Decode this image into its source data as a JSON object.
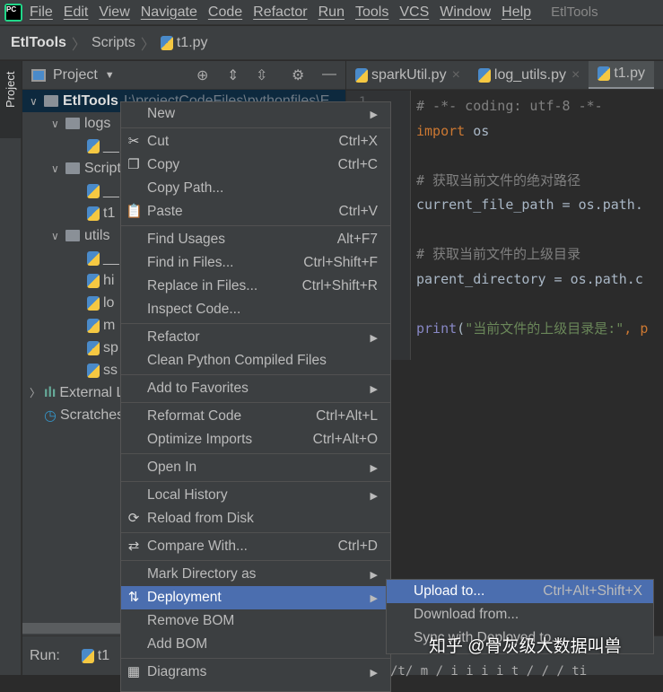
{
  "menubar": {
    "items": [
      "File",
      "Edit",
      "View",
      "Navigate",
      "Code",
      "Refactor",
      "Run",
      "Tools",
      "VCS",
      "Window",
      "Help"
    ],
    "title": "EtlTools"
  },
  "breadcrumb": {
    "root": "EtlTools",
    "folder": "Scripts",
    "file": "t1.py"
  },
  "sidestrip": {
    "label": "Project"
  },
  "project_panel": {
    "title": "Project"
  },
  "tree": [
    {
      "label": "EtlTools",
      "path": "I:\\projectCodeFiles\\pythonfiles\\E",
      "type": "root",
      "depth": 0,
      "expanded": true
    },
    {
      "label": "logs",
      "type": "folder",
      "depth": 1,
      "expanded": true
    },
    {
      "label": "__",
      "type": "file",
      "depth": 2
    },
    {
      "label": "Scripts",
      "type": "folder",
      "depth": 1,
      "expanded": true
    },
    {
      "label": "__",
      "type": "file",
      "depth": 2
    },
    {
      "label": "t1",
      "type": "file",
      "depth": 2
    },
    {
      "label": "utils",
      "type": "folder",
      "depth": 1,
      "expanded": true
    },
    {
      "label": "__",
      "type": "file",
      "depth": 2
    },
    {
      "label": "hi",
      "type": "file",
      "depth": 2
    },
    {
      "label": "lo",
      "type": "file",
      "depth": 2
    },
    {
      "label": "m",
      "type": "file",
      "depth": 2
    },
    {
      "label": "sp",
      "type": "file",
      "depth": 2
    },
    {
      "label": "ss",
      "type": "file",
      "depth": 2
    },
    {
      "label": "External Libraries",
      "type": "lib",
      "depth": 0,
      "expanded": false
    },
    {
      "label": "Scratches",
      "type": "scratch",
      "depth": 0
    }
  ],
  "editor_tabs": [
    {
      "label": "sparkUtil.py"
    },
    {
      "label": "log_utils.py"
    },
    {
      "label": "t1.py",
      "active": true
    }
  ],
  "gutter": {
    "line1": "1"
  },
  "code": {
    "l1": "# -*- coding: utf-8 -*-",
    "l2_kw": "import",
    "l2_rest": " os",
    "l4": "# 获取当前文件的绝对路径",
    "l5": "current_file_path = os.path.",
    "l7": "# 获取当前文件的上级目录",
    "l8": "parent_directory = os.path.c",
    "l10_fn": "print",
    "l10_p": "(",
    "l10_str": "\"当前文件的上级目录是:\"",
    "l10_rest": ", p"
  },
  "run": {
    "label": "Run:",
    "config": "t1"
  },
  "console": {
    "text": "/t/ m / i i i i  t /  /  / ti"
  },
  "context_menu": [
    {
      "label": "New",
      "submenu": true
    },
    "sep",
    {
      "label": "Cut",
      "shortcut": "Ctrl+X",
      "icon": "scissors"
    },
    {
      "label": "Copy",
      "shortcut": "Ctrl+C",
      "icon": "copy"
    },
    {
      "label": "Copy Path..."
    },
    {
      "label": "Paste",
      "shortcut": "Ctrl+V",
      "icon": "paste"
    },
    "sep",
    {
      "label": "Find Usages",
      "shortcut": "Alt+F7"
    },
    {
      "label": "Find in Files...",
      "shortcut": "Ctrl+Shift+F"
    },
    {
      "label": "Replace in Files...",
      "shortcut": "Ctrl+Shift+R"
    },
    {
      "label": "Inspect Code..."
    },
    "sep",
    {
      "label": "Refactor",
      "submenu": true
    },
    {
      "label": "Clean Python Compiled Files"
    },
    "sep",
    {
      "label": "Add to Favorites",
      "submenu": true
    },
    "sep",
    {
      "label": "Reformat Code",
      "shortcut": "Ctrl+Alt+L"
    },
    {
      "label": "Optimize Imports",
      "shortcut": "Ctrl+Alt+O"
    },
    "sep",
    {
      "label": "Open In",
      "submenu": true
    },
    "sep",
    {
      "label": "Local History",
      "submenu": true
    },
    {
      "label": "Reload from Disk",
      "icon": "reload"
    },
    "sep",
    {
      "label": "Compare With...",
      "shortcut": "Ctrl+D",
      "icon": "compare"
    },
    "sep",
    {
      "label": "Mark Directory as",
      "submenu": true
    },
    {
      "label": "Deployment",
      "submenu": true,
      "icon": "deploy",
      "highlighted": true
    },
    {
      "label": "Remove BOM"
    },
    {
      "label": "Add BOM"
    },
    "sep",
    {
      "label": "Diagrams",
      "submenu": true,
      "icon": "diagram"
    }
  ],
  "deployment_submenu": [
    {
      "label": "Upload to...",
      "shortcut": "Ctrl+Alt+Shift+X",
      "highlighted": true
    },
    {
      "label": "Download from..."
    },
    {
      "label": "Sync with Deployed to..."
    }
  ],
  "watermark": "知乎 @骨灰级大数据叫兽",
  "colors": {
    "highlight": "#4b6eaf",
    "background": "#2b2b2b",
    "panel": "#3c3f41"
  }
}
